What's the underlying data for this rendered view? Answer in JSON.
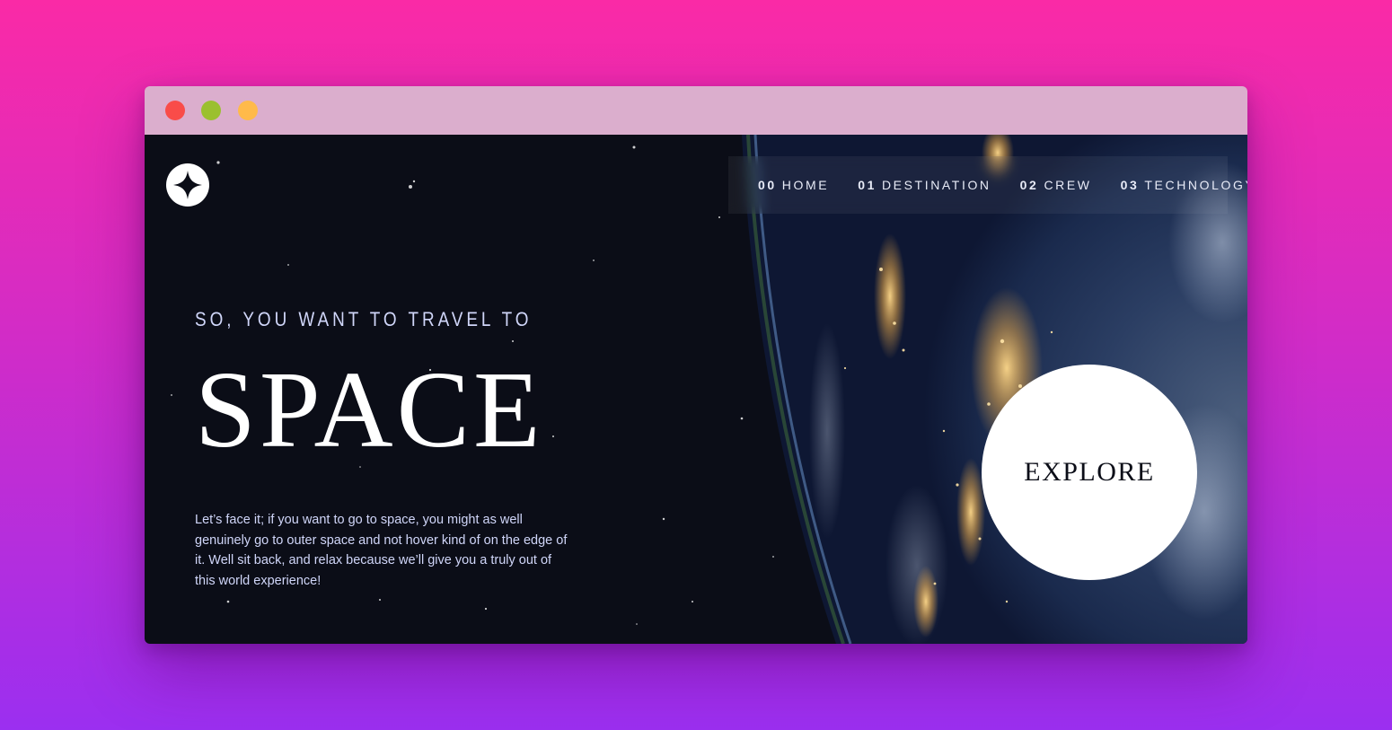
{
  "window": {
    "controls": [
      "close",
      "minimize",
      "maximize"
    ],
    "colors": {
      "close": "#f94c49",
      "minimize": "#9bc02f",
      "maximize": "#ffba4a",
      "titlebar": "#dbaecd"
    }
  },
  "site": {
    "logo_icon": "four-point-star-icon",
    "nav": [
      {
        "num": "00",
        "label": "HOME"
      },
      {
        "num": "01",
        "label": "DESTINATION"
      },
      {
        "num": "02",
        "label": "CREW"
      },
      {
        "num": "03",
        "label": "TECHNOLOGY"
      }
    ]
  },
  "hero": {
    "eyebrow": "SO, YOU WANT TO TRAVEL TO",
    "title": "SPACE",
    "body": "Let’s face it; if you want to go to space, you might as well genuinely go to outer space and not hover kind of on the edge of it. Well sit back, and relax because we’ll give you a truly out of this world experience!",
    "cta_label": "EXPLORE"
  },
  "colors": {
    "background": "#0b0d17",
    "text_light": "#d0d6f9",
    "white": "#ffffff"
  }
}
